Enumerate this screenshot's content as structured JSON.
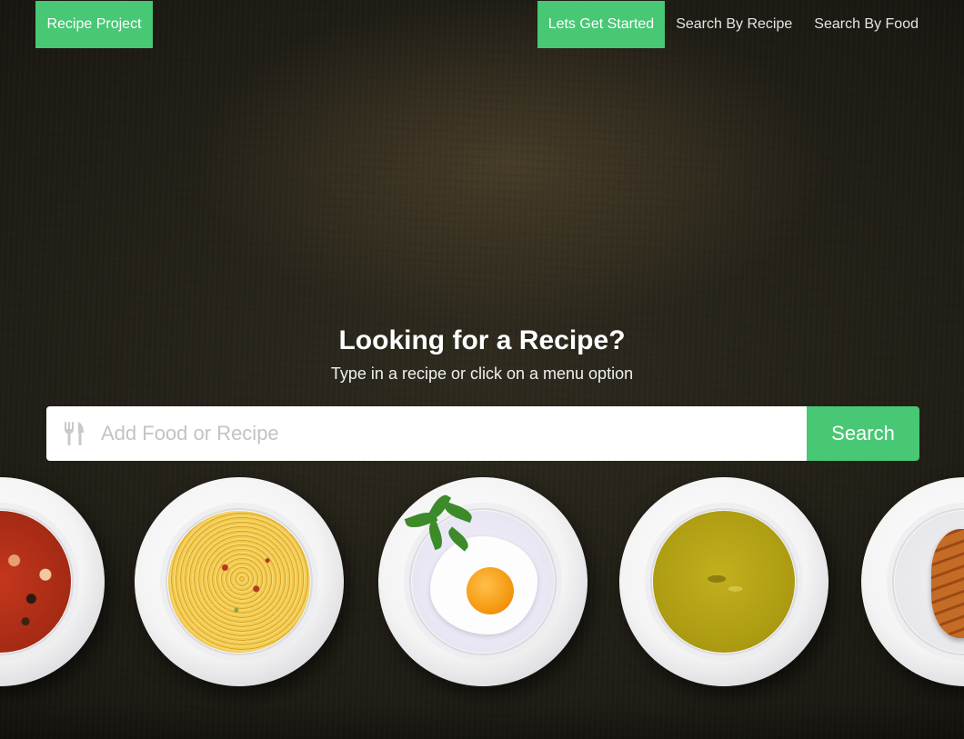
{
  "nav": {
    "brand": "Recipe Project",
    "items": [
      {
        "label": "Lets Get Started",
        "active": true
      },
      {
        "label": "Search By Recipe",
        "active": false
      },
      {
        "label": "Search By Food",
        "active": false
      }
    ]
  },
  "hero": {
    "title": "Looking for a Recipe?",
    "subtitle": "Type in a recipe or click on a menu option"
  },
  "search": {
    "placeholder": "Add Food or Recipe",
    "value": "",
    "icon": "fork-knife-icon",
    "button_label": "Search"
  },
  "plates": [
    {
      "name": "tomato-soup"
    },
    {
      "name": "spaghetti"
    },
    {
      "name": "fried-egg"
    },
    {
      "name": "pea-soup"
    },
    {
      "name": "croissant"
    }
  ],
  "colors": {
    "accent": "#48c774",
    "background": "#22201a"
  }
}
